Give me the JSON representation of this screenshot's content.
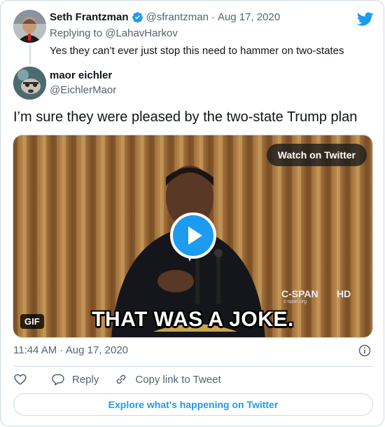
{
  "parent_tweet": {
    "author_name": "Seth Frantzman",
    "author_handle": "@sfrantzman",
    "separator": "·",
    "date": "Aug 17, 2020",
    "replying_to": "Replying to @LahavHarkov",
    "text": "Yes they can’t ever just stop this need to hammer on two-states"
  },
  "tweet": {
    "author_name": "maor eichler",
    "author_handle": "@EichlerMaor",
    "text": "I’m sure they were pleased by the two-state Trump plan",
    "timestamp": "11:44 AM · Aug 17, 2020"
  },
  "media": {
    "watch_label": "Watch on Twitter",
    "gif_badge": "GIF",
    "caption": "THAT WAS A JOKE.",
    "broadcaster": "C-SPAN",
    "broadcaster_sub": "c-span.org",
    "quality_badge": "HD"
  },
  "actions": {
    "reply_label": "Reply",
    "copy_label": "Copy link to Tweet"
  },
  "explore_label": "Explore what's happening on Twitter",
  "icons": {
    "brand": "twitter-bird-icon",
    "verified": "verified-badge-icon",
    "info": "info-icon",
    "like": "heart-icon",
    "reply": "speech-bubble-icon",
    "copy": "link-icon",
    "play": "play-icon"
  },
  "colors": {
    "brand_blue": "#1d9bf0",
    "text_primary": "#0f1419",
    "text_secondary": "#536471",
    "border": "#cfd9de"
  }
}
